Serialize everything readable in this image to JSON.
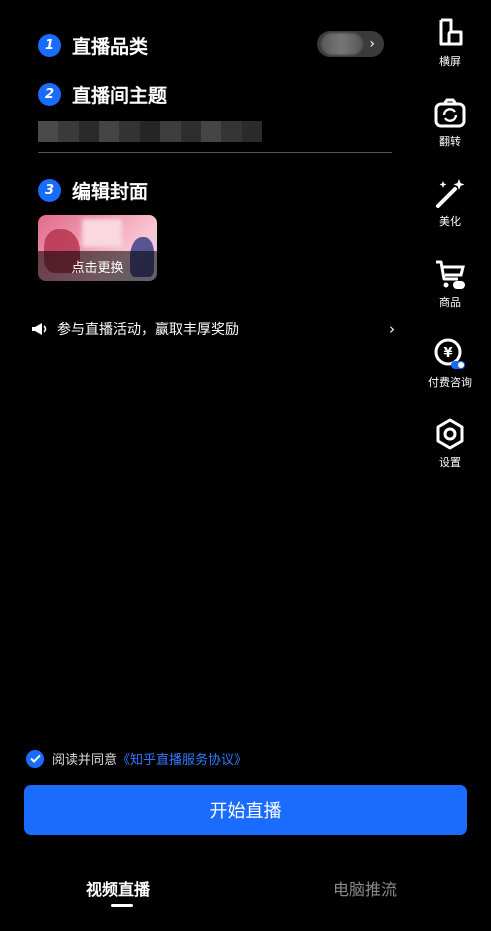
{
  "steps": [
    {
      "number": "1",
      "label": "直播品类"
    },
    {
      "number": "2",
      "label": "直播间主题"
    },
    {
      "number": "3",
      "label": "编辑封面"
    }
  ],
  "category_selector": {
    "chevron": "›",
    "icon": "chevron-right-icon"
  },
  "cover": {
    "change_label": "点击更换"
  },
  "activity": {
    "text": "参与直播活动，赢取丰厚奖励",
    "icon": "megaphone-icon",
    "arrow": "›"
  },
  "side_tools": [
    {
      "label": "横屏",
      "icon": "landscape-icon"
    },
    {
      "label": "翻转",
      "icon": "camera-flip-icon"
    },
    {
      "label": "美化",
      "icon": "magic-wand-icon"
    },
    {
      "label": "商品",
      "icon": "shopping-cart-icon"
    },
    {
      "label": "付费咨询",
      "icon": "paid-consult-icon"
    },
    {
      "label": "设置",
      "icon": "settings-hex-icon"
    }
  ],
  "agreement": {
    "checked": true,
    "text": "阅读并同意",
    "link": "《知乎直播服务协议》"
  },
  "start_button": {
    "label": "开始直播"
  },
  "bottom_tabs": [
    {
      "label": "视频直播",
      "active": true
    },
    {
      "label": "电脑推流",
      "active": false
    }
  ],
  "colors": {
    "accent": "#1a6bff",
    "background": "#000000",
    "inactive_tab": "#8a8a8a"
  }
}
